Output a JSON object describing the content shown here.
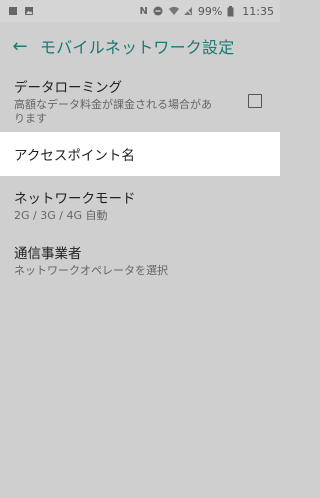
{
  "status": {
    "battery": "99%",
    "time": "11:35",
    "nfc": "N"
  },
  "toolbar": {
    "back_glyph": "←",
    "title": "モバイルネットワーク設定"
  },
  "items": [
    {
      "title": "データローミング",
      "summary": "高額なデータ料金が課金される場合があります"
    },
    {
      "title": "アクセスポイント名"
    },
    {
      "title": "ネットワークモード",
      "summary": "2G / 3G / 4G 自動"
    },
    {
      "title": "通信事業者",
      "summary": "ネットワークオペレータを選択"
    }
  ]
}
